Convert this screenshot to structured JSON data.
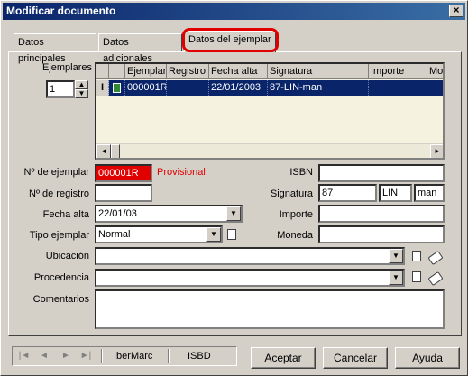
{
  "window": {
    "title": "Modificar documento",
    "close": "×"
  },
  "tabs": [
    {
      "label": "Datos principales"
    },
    {
      "label": "Datos adicionales"
    },
    {
      "label": "Datos del ejemplar"
    }
  ],
  "ejemplares": {
    "label": "Ejemplares",
    "value": "1"
  },
  "grid": {
    "columns": [
      "Ejemplar",
      "Registro",
      "Fecha alta",
      "Signatura",
      "Importe",
      "Mo"
    ],
    "rows": [
      {
        "indicator": "I",
        "ejemplar": "000001R",
        "registro": "",
        "fecha_alta": "22/01/2003",
        "signatura": "87-LIN-man",
        "importe": ""
      }
    ]
  },
  "fields": {
    "num_ejemplar": {
      "label": "Nº de ejemplar",
      "value": "000001R",
      "status": "Provisional"
    },
    "num_registro": {
      "label": "Nº de registro",
      "value": ""
    },
    "fecha_alta": {
      "label": "Fecha alta",
      "value": "22/01/03"
    },
    "tipo_ejemplar": {
      "label": "Tipo ejemplar",
      "value": "Normal"
    },
    "isbn": {
      "label": "ISBN",
      "value": ""
    },
    "signatura": {
      "label": "Signatura",
      "part1": "87",
      "part2": "LIN",
      "part3": "man"
    },
    "importe": {
      "label": "Importe",
      "value": ""
    },
    "moneda": {
      "label": "Moneda",
      "value": ""
    },
    "ubicacion": {
      "label": "Ubicación",
      "value": ""
    },
    "procedencia": {
      "label": "Procedencia",
      "value": ""
    },
    "comentarios": {
      "label": "Comentarios",
      "value": ""
    }
  },
  "nav": {
    "first": "|◄",
    "prev": "◄",
    "next": "►",
    "last": "►|",
    "ibermarc": "IberMarc",
    "isbd": "ISBD"
  },
  "buttons": {
    "accept": "Aceptar",
    "cancel": "Cancelar",
    "help": "Ayuda"
  },
  "colors": {
    "title_bar": "#0a246a",
    "selected_row": "#0a246a",
    "error_field": "#e00000",
    "tab_highlight": "#e00000"
  }
}
